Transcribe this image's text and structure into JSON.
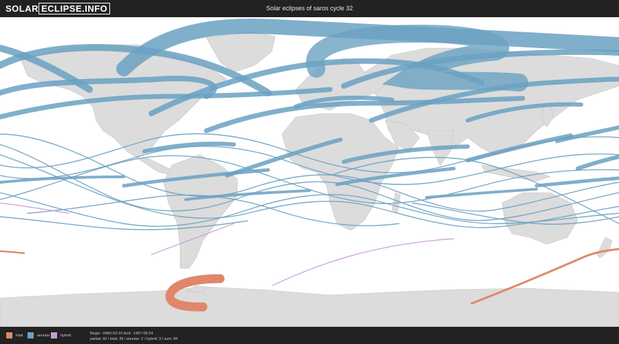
{
  "header": {
    "logo_part1": "SOLAR",
    "logo_part2": "ECLIPSE.INFO",
    "title": "Solar eclipses of saros cycle 32"
  },
  "legend": {
    "total": {
      "label": "total",
      "color": "#e0876b"
    },
    "annular": {
      "label": "annular",
      "color": "#6aa1c2"
    },
    "hybrid": {
      "label": "hybrid",
      "color": "#c79ad6"
    }
  },
  "info": {
    "line1": "Begin: -0460-03-10 End: -1957-09-24",
    "line2": "partial: 40 / total: 39 / annular: 2 / hybrid: 3 / sum: 84"
  },
  "map": {
    "land_color": "#dcdcdc",
    "ocean_color": "#ffffff"
  }
}
